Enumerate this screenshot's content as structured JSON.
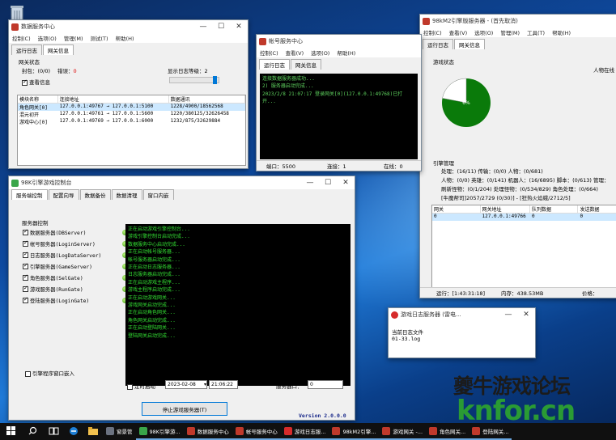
{
  "desktop": {
    "recycle_icon": "recycle-bin-icon",
    "app_icon": "app-shortcut-icon"
  },
  "data_server": {
    "title": "数据服务中心",
    "menu": [
      "控制(C)",
      "选项(O)",
      "管理(M)",
      "测试(T)",
      "帮助(H)"
    ],
    "tabs": [
      "运行日志",
      "网关信息"
    ],
    "group_label": "网关状态",
    "seal_label": "封包：(0/0)",
    "error_label": "错误：",
    "error_value": "0",
    "log_level_label": "显示日志等级：",
    "log_level_value": "2",
    "view_info_label": "查看信息",
    "columns": [
      "模块名称",
      "连接地址",
      "数据通讯"
    ],
    "rows": [
      [
        "角色网关[0]",
        "127.0.0.1:49767 → 127.0.0.1:5100",
        "1228/4900/18562568"
      ],
      [
        "混元初开",
        "127.0.0.1:49761 → 127.0.0.1:5600",
        "1220/380125/32626458"
      ],
      [
        "游戏中心[0]",
        "127.0.0.1:49769 → 127.0.0.1:6000",
        "1232/875/32629884"
      ]
    ]
  },
  "account_server": {
    "title": "帐号服务中心",
    "menu": [
      "控制(C)",
      "查看(V)",
      "选项(O)",
      "帮助(H)"
    ],
    "tabs": [
      "运行日志",
      "网关信息"
    ],
    "log_lines": [
      "连接数据服务器成功...",
      "2) 服务器启动完成...",
      "2023/2/8 21:07:17 登录网关[0](127.0.0.1:49768)已打开..."
    ],
    "status": {
      "port_label": "端口：5500",
      "conn_label": "连接：1",
      "online_label": "在线：0"
    }
  },
  "engine": {
    "title": "98kM2引擎版服务器 - (首先取消)",
    "menu": [
      "控制(C)",
      "查看(V)",
      "选项(O)",
      "管理(M)",
      "工具(T)",
      "帮助(H)"
    ],
    "tabs": [
      "运行日志",
      "网关信息"
    ],
    "game_status_label": "游戏状态",
    "online_label": "人物在线",
    "pie_label": "6%",
    "pie_fraction": 0.06,
    "pie_color": "#0a7a0a",
    "mgmt_label": "引擎管理",
    "lines": [
      "处理：(16/11) 传输：(0/0) 人物：(0/681)",
      "人物：(0/0) 英雄：(0/141) 机器人：(16/6895) 脚本：(0/613) 管理：",
      "刷新怪物：(0/1/204) 处理怪物：(0/534/829) 角色处理：(0/664)",
      "[牛魔帮司]2057/2729 (0/30)] - [狂热火焰蛾/2712/5]"
    ],
    "columns": [
      "网关",
      "网关地址",
      "队列数据",
      "发送数据"
    ],
    "row": [
      "0",
      "127.0.0.1:49766",
      "0",
      "0"
    ],
    "status": {
      "run_label": "运行：[1:43:31:18]",
      "mem_label": "内存：438.53MB",
      "price_label": "价格："
    }
  },
  "controller": {
    "title": "98K引擎游戏控制台",
    "tabs": [
      "服务端控制",
      "配置向导",
      "数据备份",
      "数据清理",
      "窗口内嵌"
    ],
    "group_label": "服务器控制",
    "servers": [
      "数据服务器(DBServer)",
      "帐号服务器(LoginServer)",
      "日志服务器(LogDataServer)",
      "引擎服务器(GameServer)",
      "角色服务器(SelGate)",
      "游戏服务器(RunGate)",
      "登陆服务器(LoginGate)"
    ],
    "console_lines": [
      "正在启动游戏引擎控制台...",
      "游戏引擎控制台启动完成...",
      "数据服务中心启动完成...",
      "正在启动帐号服务器...",
      "帐号服务器启动完成...",
      "正在启动日志服务器...",
      "日志服务器启动完成...",
      "正在启动游戏主程序...",
      "游戏主程序启动完成...",
      "正在启动游戏网关...",
      "游戏网关启动完成...",
      "正在启动角色网关...",
      "角色网关启动完成...",
      "正在启动登陆网关...",
      "登陆网关启动完成..."
    ],
    "embed_label": "引擎程序窗口嵌入",
    "timer_label": "定时启动",
    "date_value": "2023-02-08",
    "time_value": "21:06:22",
    "port_label": "服务器口：",
    "port_value": "0",
    "stop_button": "停止游戏服务器(T)",
    "version": "Version 2.0.0.0"
  },
  "log_window": {
    "title": "游戏日志服务器 (雷电...",
    "current_label": "当前日志文件",
    "file_value": "01-33.log"
  },
  "watermark": {
    "top": "夔牛游戏论坛",
    "bottom": "knfor.cn"
  },
  "taskbar": {
    "items": [
      "窗景管",
      "98K引擎游...",
      "数据服务中心",
      "帐号服务中心",
      "游戏日志服...",
      "98kM2引擎...",
      "游戏网关 -...",
      "角色网关...",
      "登陆网关..."
    ]
  }
}
